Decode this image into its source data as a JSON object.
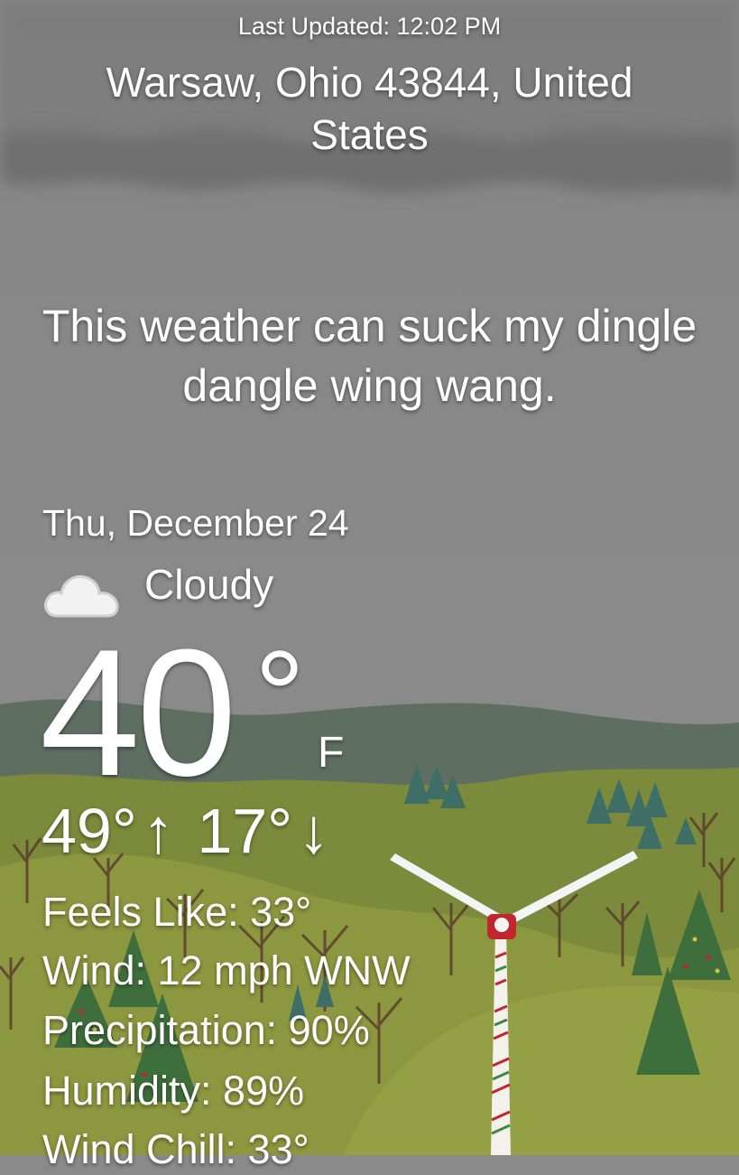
{
  "header": {
    "last_updated": "Last Updated: 12:02 PM",
    "location": "Warsaw, Ohio 43844, United States"
  },
  "message": "This weather can suck my dingle dangle wing wang.",
  "current": {
    "date": "Thu, December 24",
    "condition": "Cloudy",
    "condition_icon": "cloud-icon",
    "temperature": "40",
    "degree_symbol": "°",
    "unit": "F",
    "high": "49°",
    "high_arrow": "↑",
    "low": "17°",
    "low_arrow": "↓"
  },
  "details": {
    "feels_like": "Feels Like: 33°",
    "wind": "Wind: 12 mph WNW",
    "precipitation": "Precipitation: 90%",
    "humidity": "Humidity: 89%",
    "wind_chill": "Wind Chill: 33°"
  },
  "colors": {
    "sky": "#8a8a8a",
    "storm_cloud": "#6e6e6e",
    "far_hills": "#5b6f5e",
    "mid_hills": "#7a8a3a",
    "near_hills": "#8f9a42",
    "tree_green": "#3e6b3c",
    "turbine_accent": "#c0262d"
  }
}
